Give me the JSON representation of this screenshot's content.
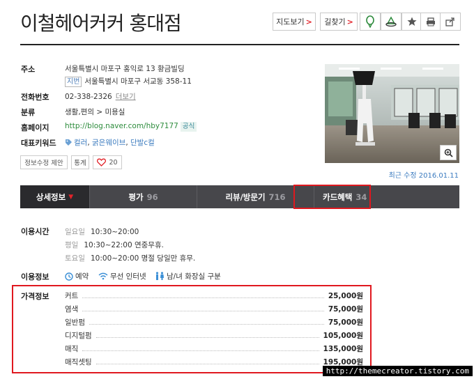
{
  "place": {
    "title": "이철헤어커커 홍대점"
  },
  "top_buttons": {
    "map_label": "지도보기",
    "route_label": "길찾기",
    "arrow": ">"
  },
  "info": {
    "address_label": "주소",
    "address": "서울특별시 마포구 홍익로 13 황금빌딩",
    "jibun_badge": "지번",
    "jibun_address": "서울특별시 마포구 서교동 358-11",
    "phone_label": "전화번호",
    "phone": "02-338-2326",
    "phone_more": "더보기",
    "category_label": "분류",
    "category": "생활,편의 > 미용실",
    "homepage_label": "홈페이지",
    "homepage": "http://blog.naver.com/hby7177",
    "official_badge": "공식",
    "keywords_label": "대표키워드",
    "keywords": [
      "컬러",
      "굵은웨이브",
      "단발c컬"
    ]
  },
  "actions": {
    "suggest_edit": "정보수정 제안",
    "stats": "통계",
    "like_count": "20"
  },
  "updated": "최근 수정 2016.01.11",
  "tabs": [
    {
      "label": "상세정보",
      "count": "",
      "active": true
    },
    {
      "label": "평가",
      "count": "96",
      "active": false
    },
    {
      "label": "리뷰/방문기",
      "count": "716",
      "active": false
    },
    {
      "label": "카드혜택",
      "count": "34",
      "active": false
    }
  ],
  "hours": {
    "label": "이용시간",
    "rows": [
      {
        "day": "일요일",
        "time": "10:30~20:00"
      },
      {
        "day": "평일",
        "time": "10:30~22:00 연중무휴."
      },
      {
        "day": "토요일",
        "time": "10:00~20:00 명절 당일만 휴무."
      }
    ]
  },
  "amenities": {
    "label": "이용정보",
    "items": [
      "예약",
      "무선 인터넷",
      "남/녀 화장실 구분"
    ]
  },
  "prices": {
    "label": "가격정보",
    "items": [
      {
        "name": "커트",
        "price": "25,000원"
      },
      {
        "name": "염색",
        "price": "75,000원"
      },
      {
        "name": "일반펌",
        "price": "75,000원"
      },
      {
        "name": "디지털펌",
        "price": "105,000원"
      },
      {
        "name": "매직",
        "price": "135,000원"
      },
      {
        "name": "매직셋팅",
        "price": "195,000원"
      }
    ]
  },
  "watermark": "http://themecreator.tistory.com",
  "colors": {
    "accent_red": "#e0181f",
    "tab_bar": "#47474b",
    "link_blue": "#3b7bbf",
    "url_green": "#2d8c3c"
  }
}
